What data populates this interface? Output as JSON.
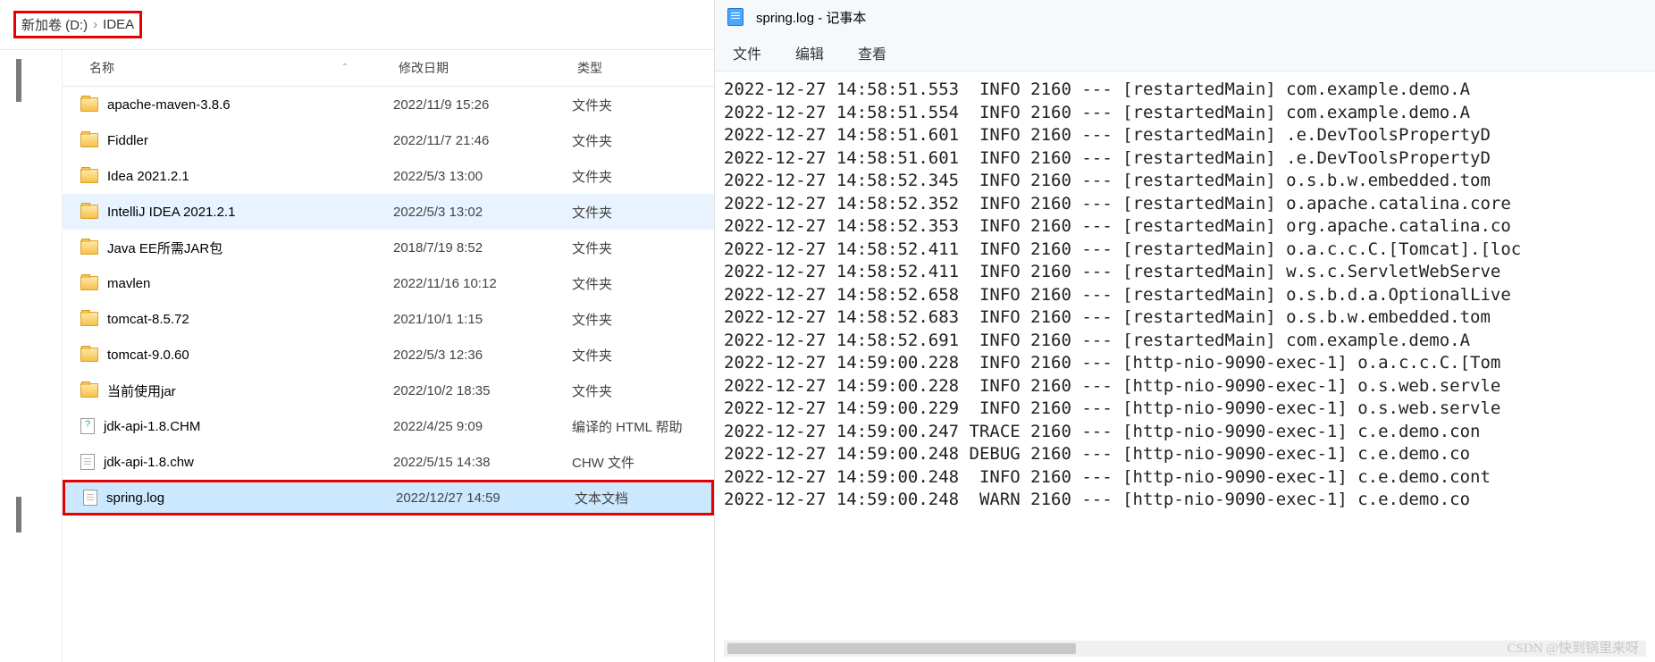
{
  "explorer": {
    "breadcrumb": {
      "part1": "新加卷 (D:)",
      "sep": "›",
      "part2": "IDEA"
    },
    "columns": {
      "name": "名称",
      "date": "修改日期",
      "type": "类型",
      "sort": "ˆ"
    },
    "rows": [
      {
        "icon": "folder",
        "name": "apache-maven-3.8.6",
        "date": "2022/11/9 15:26",
        "type": "文件夹",
        "state": ""
      },
      {
        "icon": "folder",
        "name": "Fiddler",
        "date": "2022/11/7 21:46",
        "type": "文件夹",
        "state": ""
      },
      {
        "icon": "folder",
        "name": "Idea 2021.2.1",
        "date": "2022/5/3 13:00",
        "type": "文件夹",
        "state": ""
      },
      {
        "icon": "folder",
        "name": "IntelliJ IDEA 2021.2.1",
        "date": "2022/5/3 13:02",
        "type": "文件夹",
        "state": "hover"
      },
      {
        "icon": "folder",
        "name": "Java EE所需JAR包",
        "date": "2018/7/19 8:52",
        "type": "文件夹",
        "state": ""
      },
      {
        "icon": "folder",
        "name": "mavlen",
        "date": "2022/11/16 10:12",
        "type": "文件夹",
        "state": ""
      },
      {
        "icon": "folder",
        "name": "tomcat-8.5.72",
        "date": "2021/10/1 1:15",
        "type": "文件夹",
        "state": ""
      },
      {
        "icon": "folder",
        "name": "tomcat-9.0.60",
        "date": "2022/5/3 12:36",
        "type": "文件夹",
        "state": ""
      },
      {
        "icon": "folder",
        "name": "当前使用jar",
        "date": "2022/10/2 18:35",
        "type": "文件夹",
        "state": ""
      },
      {
        "icon": "chm",
        "name": "jdk-api-1.8.CHM",
        "date": "2022/4/25 9:09",
        "type": "编译的 HTML 帮助",
        "state": ""
      },
      {
        "icon": "file",
        "name": "jdk-api-1.8.chw",
        "date": "2022/5/15 14:38",
        "type": "CHW 文件",
        "state": ""
      },
      {
        "icon": "file",
        "name": "spring.log",
        "date": "2022/12/27 14:59",
        "type": "文本文档",
        "state": "selected-highlight"
      }
    ]
  },
  "notepad": {
    "title": "spring.log - 记事本",
    "menu": {
      "file": "文件",
      "edit": "编辑",
      "view": "查看"
    },
    "lines": [
      "2022-12-27 14:58:51.553  INFO 2160 --- [restartedMain] com.example.demo.A",
      "2022-12-27 14:58:51.554  INFO 2160 --- [restartedMain] com.example.demo.A",
      "2022-12-27 14:58:51.601  INFO 2160 --- [restartedMain] .e.DevToolsPropertyD",
      "2022-12-27 14:58:51.601  INFO 2160 --- [restartedMain] .e.DevToolsPropertyD",
      "2022-12-27 14:58:52.345  INFO 2160 --- [restartedMain] o.s.b.w.embedded.tom",
      "2022-12-27 14:58:52.352  INFO 2160 --- [restartedMain] o.apache.catalina.core",
      "2022-12-27 14:58:52.353  INFO 2160 --- [restartedMain] org.apache.catalina.co",
      "2022-12-27 14:58:52.411  INFO 2160 --- [restartedMain] o.a.c.c.C.[Tomcat].[loc",
      "2022-12-27 14:58:52.411  INFO 2160 --- [restartedMain] w.s.c.ServletWebServe",
      "2022-12-27 14:58:52.658  INFO 2160 --- [restartedMain] o.s.b.d.a.OptionalLive",
      "2022-12-27 14:58:52.683  INFO 2160 --- [restartedMain] o.s.b.w.embedded.tom",
      "2022-12-27 14:58:52.691  INFO 2160 --- [restartedMain] com.example.demo.A",
      "2022-12-27 14:59:00.228  INFO 2160 --- [http-nio-9090-exec-1] o.a.c.c.C.[Tom",
      "2022-12-27 14:59:00.228  INFO 2160 --- [http-nio-9090-exec-1] o.s.web.servle",
      "2022-12-27 14:59:00.229  INFO 2160 --- [http-nio-9090-exec-1] o.s.web.servle",
      "2022-12-27 14:59:00.247 TRACE 2160 --- [http-nio-9090-exec-1] c.e.demo.con",
      "2022-12-27 14:59:00.248 DEBUG 2160 --- [http-nio-9090-exec-1] c.e.demo.co",
      "2022-12-27 14:59:00.248  INFO 2160 --- [http-nio-9090-exec-1] c.e.demo.cont",
      "2022-12-27 14:59:00.248  WARN 2160 --- [http-nio-9090-exec-1] c.e.demo.co"
    ]
  },
  "watermark": "CSDN @快到锅里来呀"
}
